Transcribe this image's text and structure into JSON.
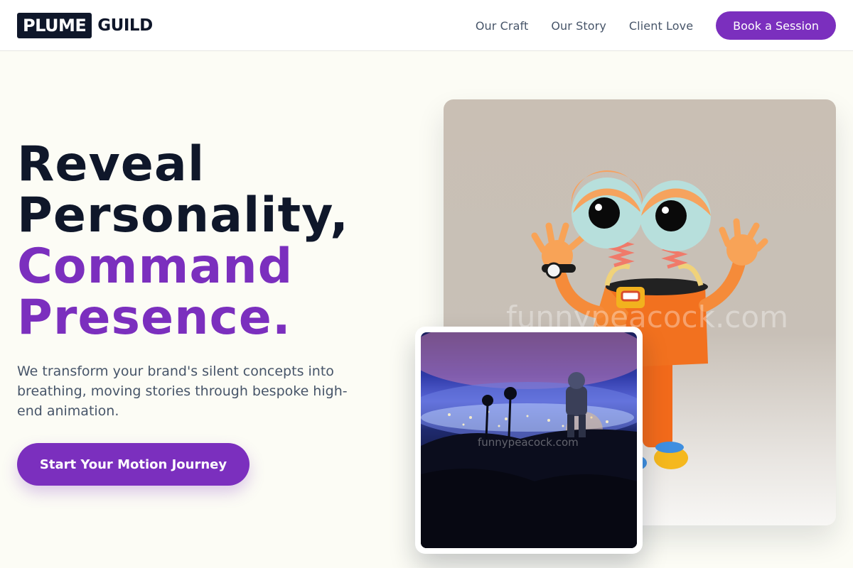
{
  "brand": {
    "logo_box_text": "PLUME",
    "logo_text": "GUILD"
  },
  "nav": {
    "links": [
      "Our Craft",
      "Our Story",
      "Client Love"
    ],
    "cta_label": "Book a Session"
  },
  "hero": {
    "headline_line1": "Reveal",
    "headline_line2": "Personality,",
    "headline_line3": "Command",
    "headline_line4": "Presence.",
    "subtext": "We transform your brand's silent concepts into breathing, moving stories through bespoke high-end animation.",
    "cta_label": "Start Your Motion Journey"
  },
  "media": {
    "main_watermark": "funnypeacock.com",
    "secondary_watermark": "funnypeacock.com"
  },
  "colors": {
    "accent": "#7b2fbe",
    "dark": "#0f172a",
    "muted": "#475569",
    "background": "#fcfcf5"
  }
}
